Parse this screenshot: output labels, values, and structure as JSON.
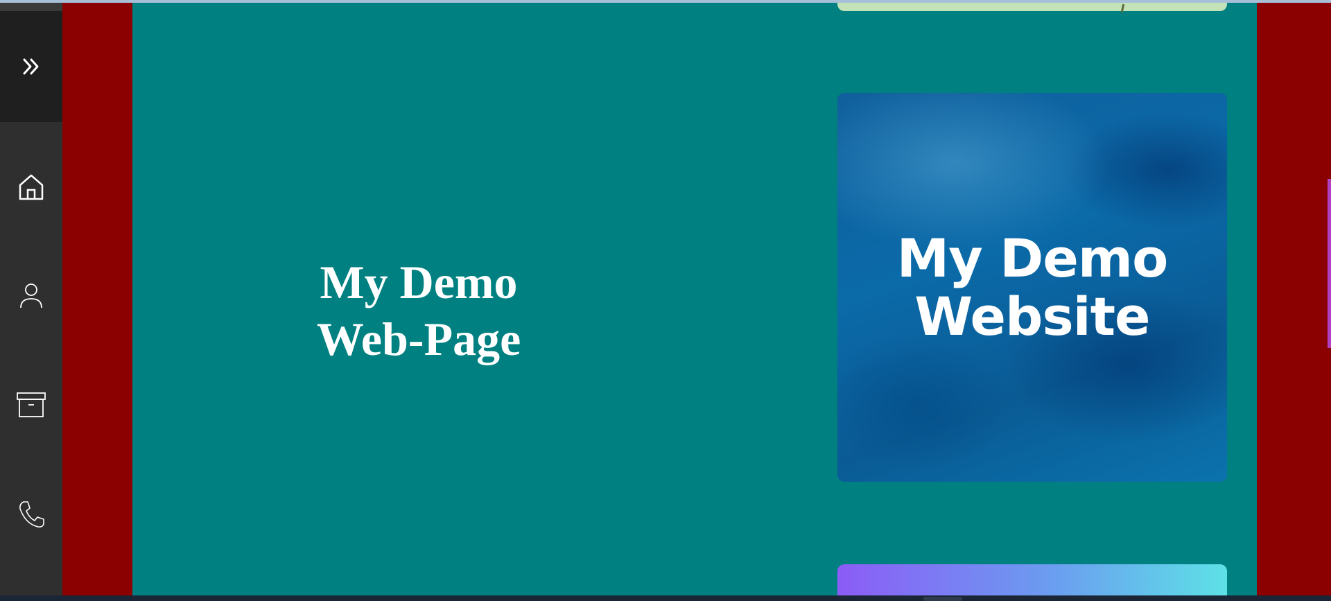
{
  "sidebar": {
    "toggle_icon": "chevron-double-right-icon",
    "items": [
      {
        "name": "home",
        "icon": "home-icon"
      },
      {
        "name": "profile",
        "icon": "user-icon"
      },
      {
        "name": "archive",
        "icon": "archive-box-icon"
      },
      {
        "name": "contact",
        "icon": "phone-icon"
      }
    ]
  },
  "main": {
    "heading_line1": "My Demo",
    "heading_line2": "Web-Page",
    "hero_card": {
      "line1": "My Demo",
      "line2": "Website"
    }
  },
  "colors": {
    "side_bars": "#8b0000",
    "main_background": "#008080",
    "sidebar_background": "#2f2f2f",
    "heading_text": "#ffffff",
    "bottom_card_gradient": [
      "#8b5cf6",
      "#5de1e6"
    ],
    "top_card": "#c4e2b8"
  }
}
